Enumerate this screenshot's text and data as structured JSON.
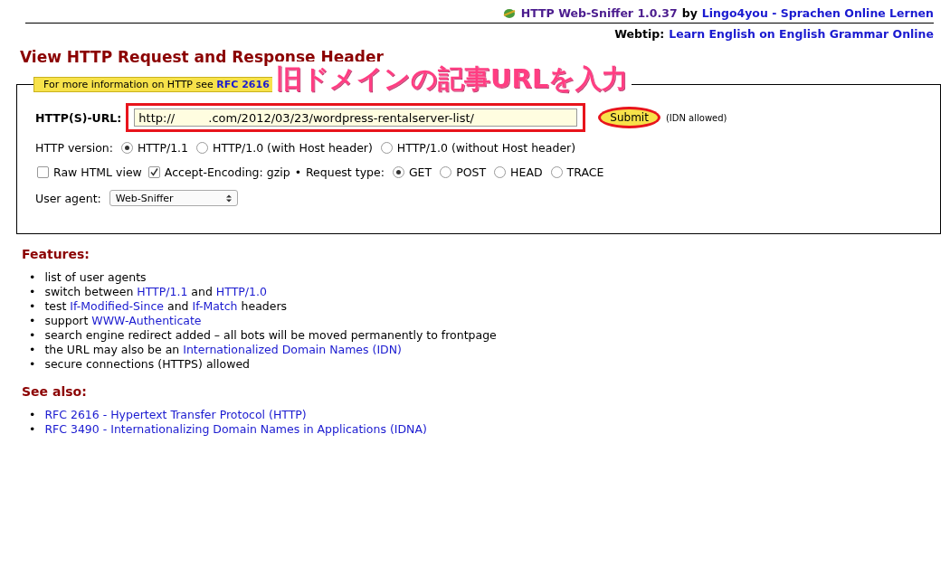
{
  "header": {
    "app_name": "HTTP Web-Sniffer 1.0.37",
    "by": "by",
    "site_link": "Lingo4you - Sprachen Online Lernen"
  },
  "webtip": {
    "label": "Webtip:",
    "link": "Learn English on English Grammar Online"
  },
  "title": "View HTTP Request and Response Header",
  "form": {
    "legend_text": "For more information on HTTP see",
    "legend_link": "RFC 2616",
    "url_label": "HTTP(S)-URL:",
    "url_value": "http://         .com/2012/03/23/wordpress-rentalserver-list/",
    "submit": "Submit",
    "idn_note": "(IDN allowed)",
    "version_label": "HTTP version:",
    "versions": [
      {
        "label": "HTTP/1.1",
        "selected": true
      },
      {
        "label": "HTTP/1.0 (with Host header)",
        "selected": false
      },
      {
        "label": "HTTP/1.0 (without Host header)",
        "selected": false
      }
    ],
    "options": [
      {
        "label": "Raw HTML view",
        "checked": false
      },
      {
        "label": "Accept-Encoding: gzip",
        "checked": true
      }
    ],
    "bullet": "•",
    "request_label": "Request type:",
    "request_types": [
      {
        "label": "GET",
        "selected": true
      },
      {
        "label": "POST",
        "selected": false
      },
      {
        "label": "HEAD",
        "selected": false
      },
      {
        "label": "TRACE",
        "selected": false
      }
    ],
    "agent_label": "User agent:",
    "agent_value": "Web-Sniffer"
  },
  "annotation": {
    "text": "旧ドメインの記事URLを入力"
  },
  "features": {
    "heading": "Features:",
    "items": [
      {
        "bullet": "•",
        "parts": [
          {
            "kind": "text",
            "text": "list of user agents"
          }
        ]
      },
      {
        "bullet": "•",
        "parts": [
          {
            "kind": "text",
            "text": "switch between "
          },
          {
            "kind": "link",
            "text": "HTTP/1.1"
          },
          {
            "kind": "text",
            "text": " and "
          },
          {
            "kind": "link",
            "text": "HTTP/1.0"
          }
        ]
      },
      {
        "bullet": "•",
        "parts": [
          {
            "kind": "text",
            "text": "test "
          },
          {
            "kind": "link",
            "text": "If-Modified-Since"
          },
          {
            "kind": "text",
            "text": " and "
          },
          {
            "kind": "link",
            "text": "If-Match"
          },
          {
            "kind": "text",
            "text": " headers"
          }
        ]
      },
      {
        "bullet": "•",
        "parts": [
          {
            "kind": "text",
            "text": "support "
          },
          {
            "kind": "link",
            "text": "WWW-Authenticate"
          }
        ]
      },
      {
        "bullet": "•",
        "parts": [
          {
            "kind": "text",
            "text": "search engine redirect added – all bots will be moved permanently to frontpage"
          }
        ]
      },
      {
        "bullet": "•",
        "parts": [
          {
            "kind": "text",
            "text": "the URL may also be an "
          },
          {
            "kind": "link",
            "text": "Internationalized Domain Names (IDN)"
          }
        ]
      },
      {
        "bullet": "•",
        "parts": [
          {
            "kind": "text",
            "text": "secure connections (HTTPS) allowed"
          }
        ]
      }
    ]
  },
  "see_also": {
    "heading": "See also:",
    "items": [
      {
        "bullet": "•",
        "text": "RFC 2616 - Hypertext Transfer Protocol (HTTP)"
      },
      {
        "bullet": "•",
        "text": "RFC 3490 - Internationalizing Domain Names in Applications (IDNA)"
      }
    ]
  }
}
